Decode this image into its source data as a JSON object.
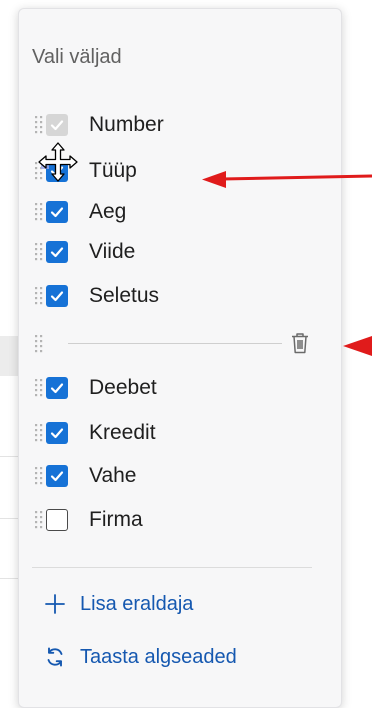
{
  "dialog": {
    "title": "Vali väljad"
  },
  "fields": [
    {
      "label": "Number",
      "state": "disabled-checked"
    },
    {
      "label": "Tüüp",
      "state": "checked"
    },
    {
      "label": "Aeg",
      "state": "checked"
    },
    {
      "label": "Viide",
      "state": "checked"
    },
    {
      "label": "Seletus",
      "state": "checked"
    },
    {
      "label": "Deebet",
      "state": "checked"
    },
    {
      "label": "Kreedit",
      "state": "checked"
    },
    {
      "label": "Vahe",
      "state": "checked"
    },
    {
      "label": "Firma",
      "state": "unchecked"
    }
  ],
  "actions": {
    "add_separator": "Lisa eraldaja",
    "restore_defaults": "Taasta algseaded"
  },
  "colors": {
    "accent": "#1672d6",
    "link": "#1558b0",
    "annotation_arrow": "#e01b1b"
  },
  "icons": {
    "drag_handle": "drag-grip-icon",
    "delete_separator": "trash-icon",
    "add": "plus-icon",
    "restore": "reset-arrows-icon",
    "cursor": "move-cursor-icon"
  }
}
